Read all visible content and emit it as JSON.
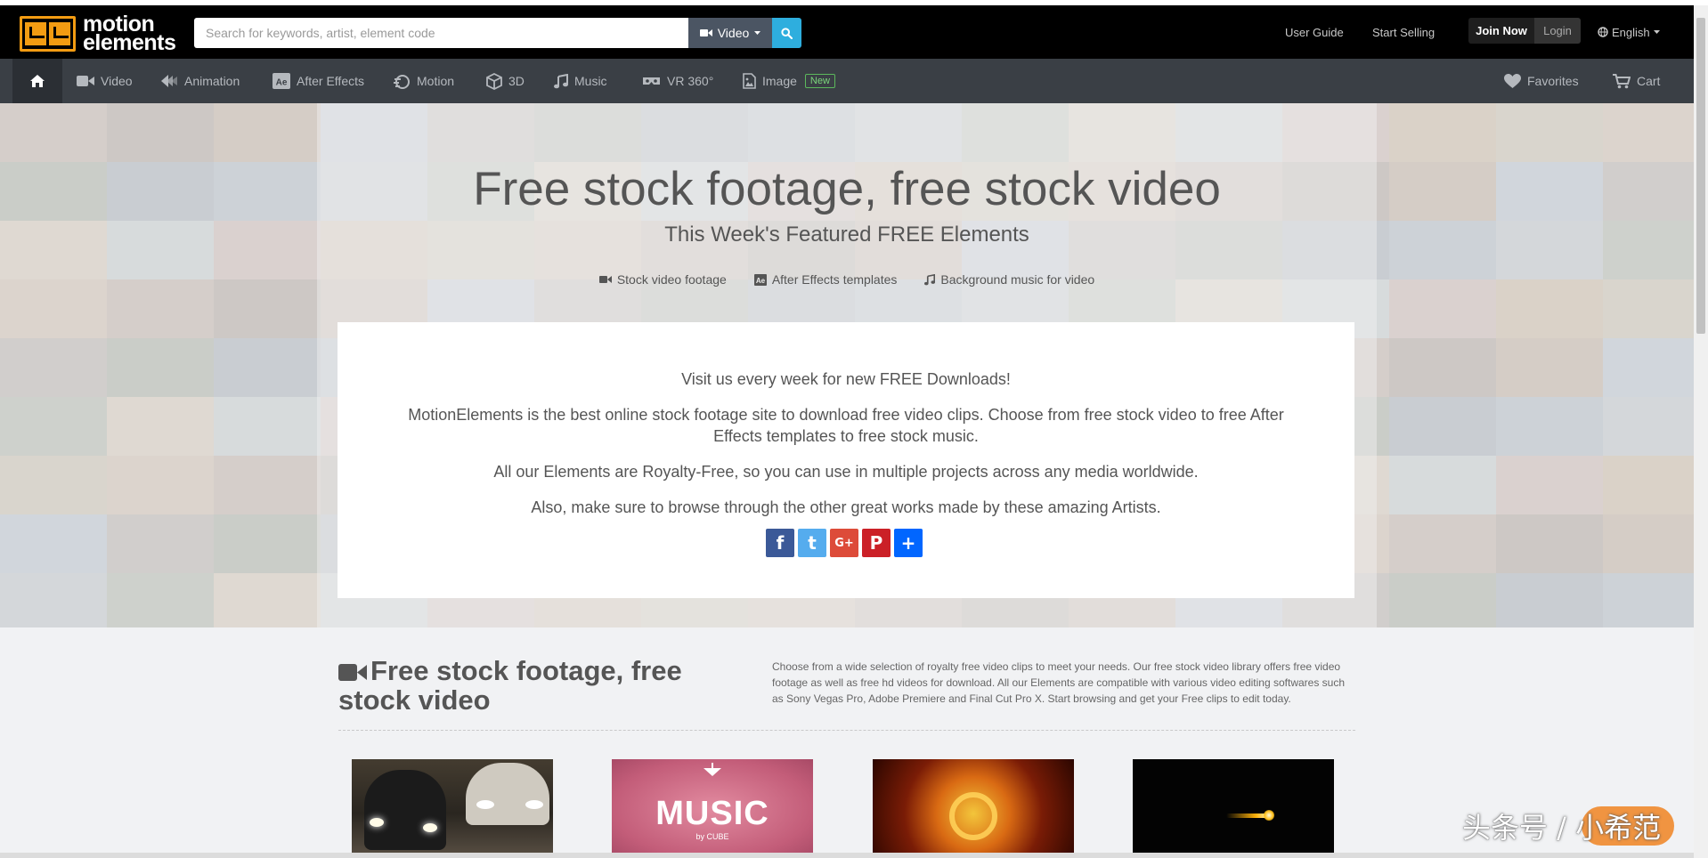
{
  "header": {
    "logo_line1": "motion",
    "logo_line2": "elements",
    "search_placeholder": "Search for keywords, artist, element code",
    "search_type": "Video",
    "links": {
      "user_guide": "User Guide",
      "start_selling": "Start Selling"
    },
    "join_label": "Join Now",
    "login_label": "Login",
    "language": "English"
  },
  "nav": {
    "items": [
      {
        "label": "Video",
        "icon": "video-camera-icon"
      },
      {
        "label": "Animation",
        "icon": "animation-icon"
      },
      {
        "label": "After Effects",
        "icon": "after-effects-icon"
      },
      {
        "label": "Motion",
        "icon": "motion-icon"
      },
      {
        "label": "3D",
        "icon": "cube-icon"
      },
      {
        "label": "Music",
        "icon": "music-note-icon"
      },
      {
        "label": "VR 360°",
        "icon": "vr-icon"
      },
      {
        "label": "Image",
        "icon": "image-icon"
      }
    ],
    "new_badge": "New",
    "favorites": "Favorites",
    "cart": "Cart"
  },
  "hero": {
    "title": "Free stock footage, free stock video",
    "subtitle": "This Week's Featured FREE Elements",
    "links": [
      "Stock video footage",
      "After Effects templates",
      "Background music for video"
    ],
    "card": {
      "p1": "Visit us every week for new FREE Downloads!",
      "p2": "MotionElements is the best online stock footage site to download free video clips. Choose from free stock video to free After Effects templates to free stock music.",
      "p3": "All our Elements are Royalty-Free, so you can use in multiple projects across any media worldwide.",
      "p4": "Also, make sure to browse through the other great works made by these amazing Artists."
    },
    "social": [
      {
        "label": "f",
        "color": "#3b5998",
        "icon": "facebook-icon"
      },
      {
        "label": "t",
        "color": "#55acee",
        "icon": "twitter-icon"
      },
      {
        "label": "G+",
        "color": "#dd4b39",
        "icon": "google-plus-icon"
      },
      {
        "label": "P",
        "color": "#cb2027",
        "icon": "pinterest-icon"
      },
      {
        "label": "+",
        "color": "#0166ff",
        "icon": "share-plus-icon"
      }
    ]
  },
  "section": {
    "title": "Free stock footage, free stock video",
    "description": "Choose from a wide selection of royalty free video clips to meet your needs. Our free stock video library offers free video footage as well as free hd videos for download. All our Elements are compatible with various video editing softwares such as Sony Vegas Pro, Adobe Premiere and Final Cut Pro X. Start browsing and get your Free clips to edit today.",
    "thumb2_title": "MUSIC",
    "thumb2_sub": "by CUBE"
  },
  "watermark": "头条号 / 小希范",
  "colors": {
    "topbar": "#000000",
    "navbar": "#3a3f45",
    "search_button": "#2eaede",
    "accent_orange": "#f39c12",
    "new_badge": "#5cb85c"
  }
}
